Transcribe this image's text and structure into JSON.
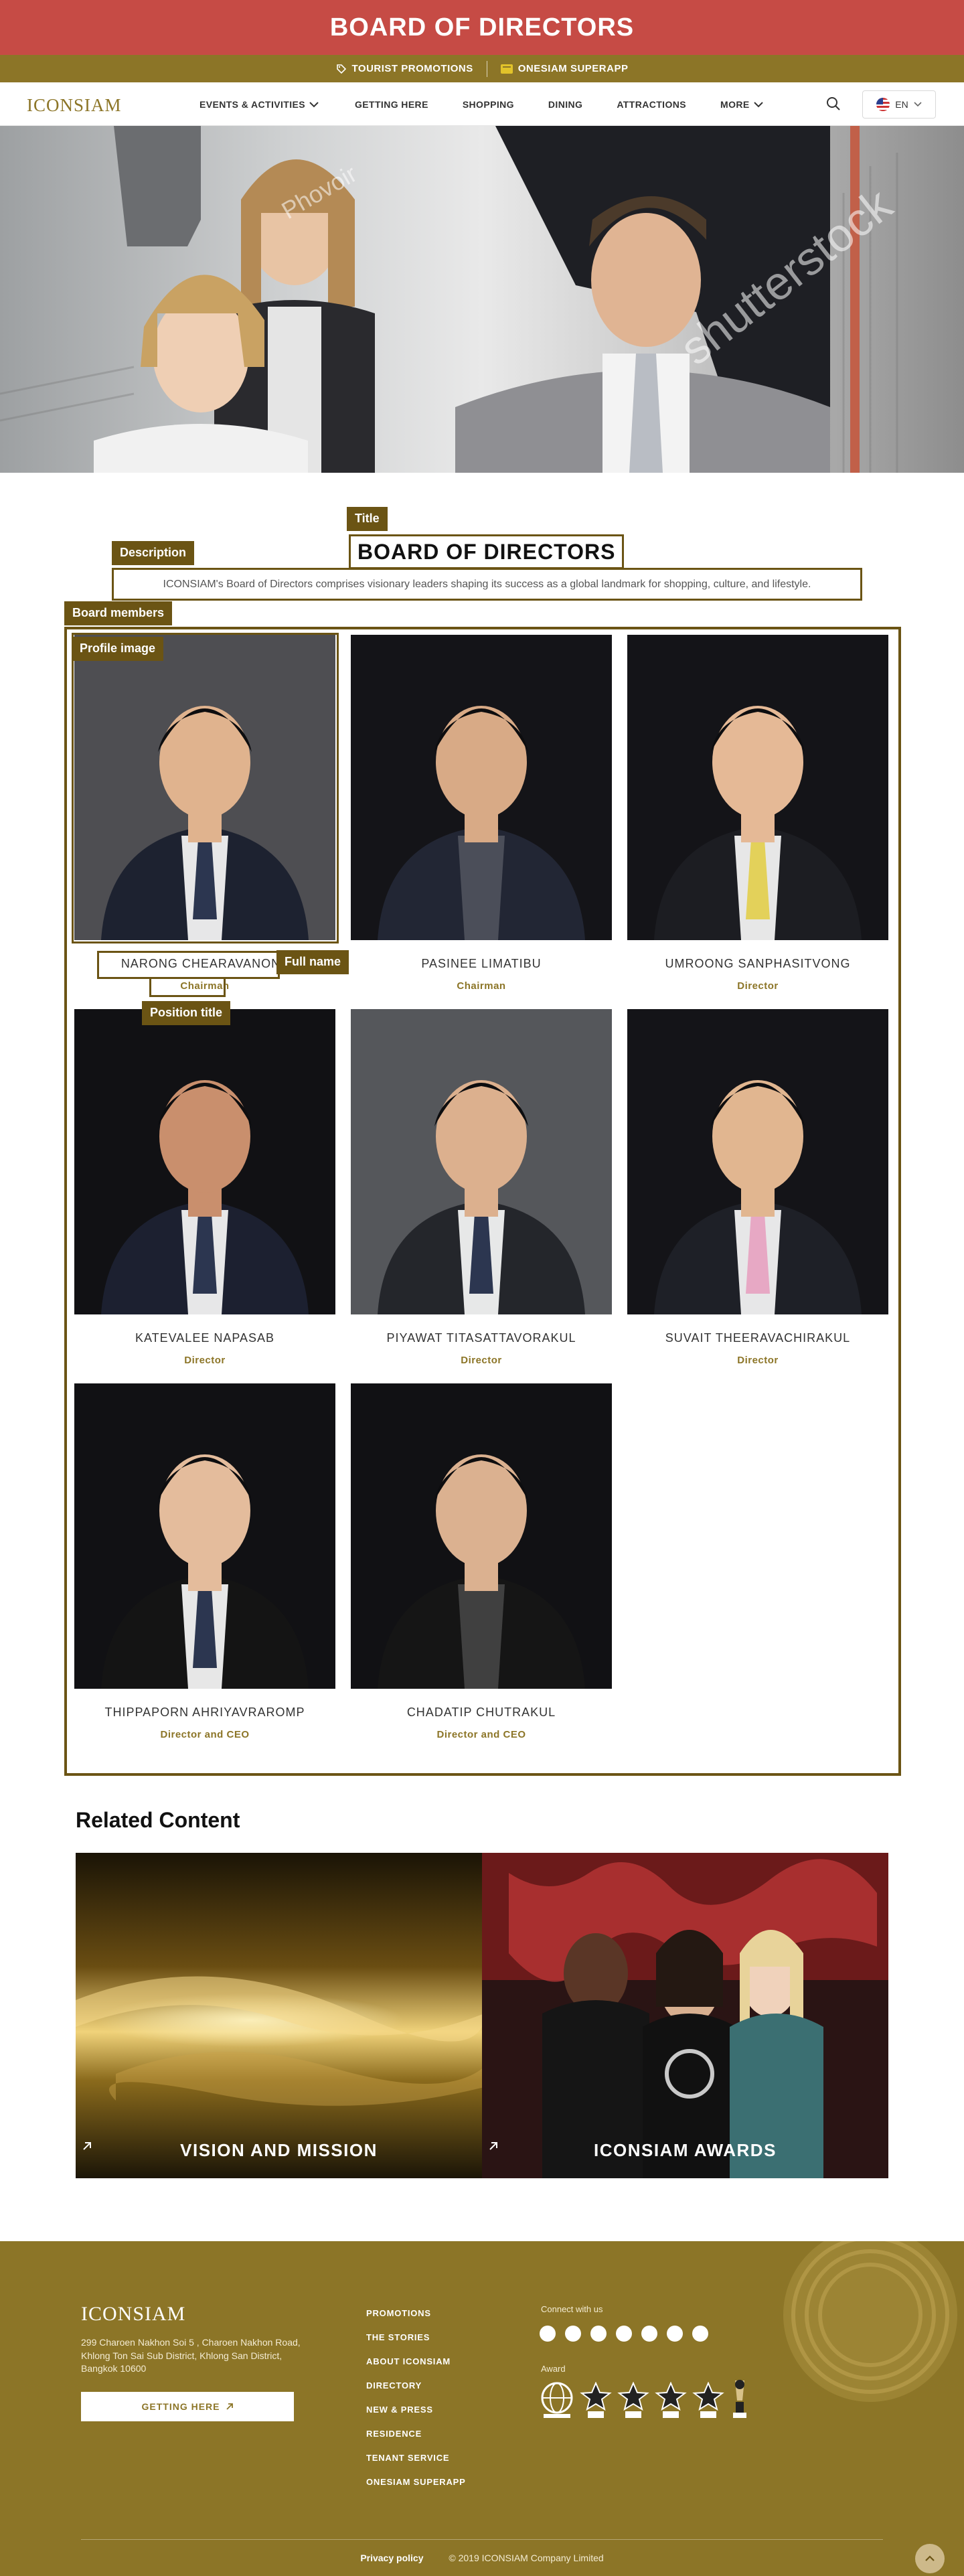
{
  "banner": {
    "title": "BOARD OF DIRECTORS"
  },
  "promo": {
    "tourist": "TOURIST PROMOTIONS",
    "superapp": "ONESIAM SUPERAPP"
  },
  "nav": {
    "logo": "ICONSIAM",
    "items": [
      "EVENTS & ACTIVITIES",
      "GETTING HERE",
      "SHOPPING",
      "DINING",
      "ATTRACTIONS",
      "MORE"
    ],
    "language": "EN"
  },
  "hero": {
    "watermark_1": "Phovoir",
    "watermark_2": "shutterstock"
  },
  "annotations": {
    "title": "Title",
    "description": "Description",
    "board_members": "Board members",
    "profile_image": "Profile image",
    "full_name": "Full name",
    "position_title": "Position title"
  },
  "section": {
    "title": "BOARD OF DIRECTORS",
    "description": "ICONSIAM's Board of Directors comprises visionary leaders shaping its success as a global landmark for shopping, culture, and lifestyle."
  },
  "members": [
    {
      "name": "NARONG CHEARAVANONT",
      "position": "Chairman"
    },
    {
      "name": "PASINEE LIMATIBU",
      "position": "Chairman"
    },
    {
      "name": "UMROONG SANPHASITVONG",
      "position": "Director"
    },
    {
      "name": "KATEVALEE NAPASAB",
      "position": "Director"
    },
    {
      "name": "PIYAWAT TITASATTAVORAKUL",
      "position": "Director"
    },
    {
      "name": "SUVAIT THEERAVACHIRAKUL",
      "position": "Director"
    },
    {
      "name": "THIPPAPORN AHRIYAVRAROMP",
      "position": "Director and CEO"
    },
    {
      "name": "CHADATIP CHUTRAKUL",
      "position": "Director and CEO"
    }
  ],
  "related": {
    "title": "Related Content",
    "items": [
      "VISION AND MISSION",
      "ICONSIAM AWARDS"
    ]
  },
  "footer": {
    "logo": "ICONSIAM",
    "address": "299 Charoen Nakhon Soi 5 , Charoen Nakhon Road, Khlong Ton Sai Sub District, Khlong San District, Bangkok 10600",
    "getting_here": "GETTING HERE",
    "links": [
      "PROMOTIONS",
      "THE STORIES",
      "ABOUT ICONSIAM",
      "DIRECTORY",
      "NEW & PRESS",
      "RESIDENCE",
      "TENANT SERVICE",
      "ONESIAM SUPERAPP"
    ],
    "connect": "Connect with us",
    "social_icons": [
      "facebook-icon",
      "x-icon",
      "instagram-icon",
      "youtube-icon",
      "weibo-icon",
      "wechat-icon",
      "line-icon"
    ],
    "award": "Award",
    "privacy": "Privacy policy",
    "copyright": "© 2019 ICONSIAM Company Limited"
  },
  "colors": {
    "banner_red": "#c64b45",
    "gold": "#8c7527",
    "annotation": "#6b5414"
  }
}
